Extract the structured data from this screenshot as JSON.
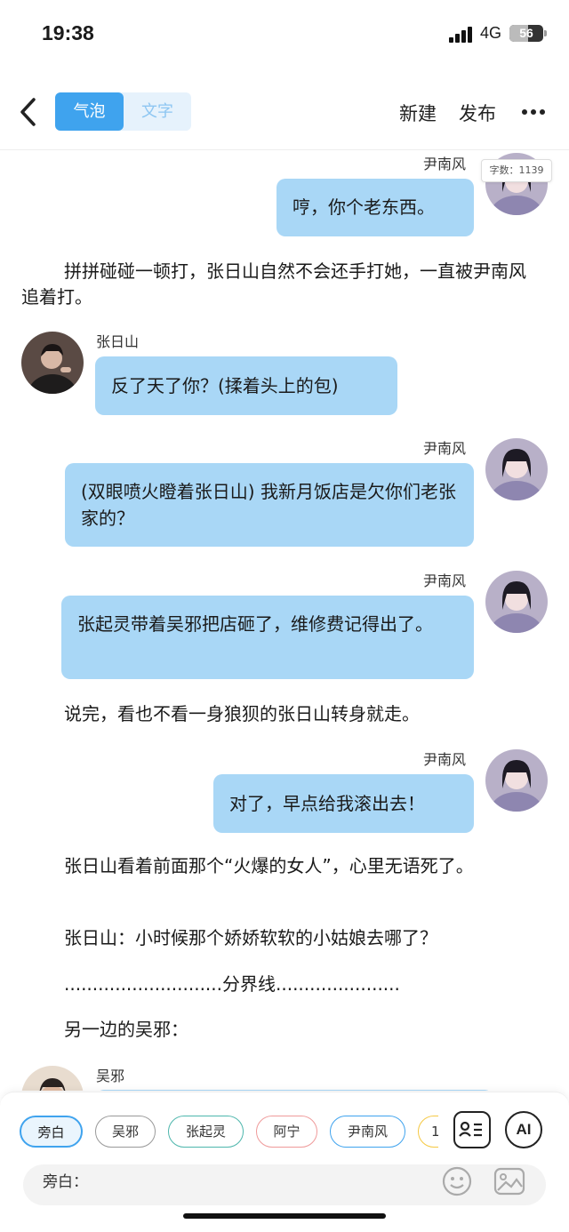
{
  "status_bar": {
    "time": "19:38",
    "network": "4G",
    "battery": "56",
    "battery_level": 0.56
  },
  "nav": {
    "tab_bubble": "气泡",
    "tab_text": "文字",
    "new": "新建",
    "publish": "发布"
  },
  "word_count": "字数：1139",
  "messages": [
    {
      "speaker": "尹南风",
      "text": "哼，你个老东西。"
    },
    {
      "narration": "拼拼碰碰一顿打，张日山自然不会还手打她，一直被尹南风追着打。"
    },
    {
      "speaker": "张日山",
      "text": "反了天了你？(揉着头上的包)"
    },
    {
      "speaker": "尹南风",
      "text": "(双眼喷火瞪着张日山) 我新月饭店是欠你们老张家的？"
    },
    {
      "speaker": "尹南风",
      "text": "张起灵带着吴邪把店砸了，维修费记得出了。"
    },
    {
      "narration": "说完，看也不看一身狼狈的张日山转身就走。"
    },
    {
      "speaker": "尹南风",
      "text": "对了，早点给我滚出去！"
    },
    {
      "narration": "张日山看着前面那个“火爆的女人”，心里无语死了。"
    },
    {
      "narration": "张日山：小时候那个娇娇软软的小姑娘去哪了？"
    },
    {
      "narration": "............................分界线......................"
    },
    {
      "narration": "另一边的吴邪："
    },
    {
      "speaker": "吴邪",
      "text": ""
    }
  ],
  "roles": [
    "旁白",
    "吴邪",
    "张起灵",
    "阿宁",
    "尹南风",
    "1"
  ],
  "role_colors": [
    "#3fa3ee",
    "#999999",
    "#4db6ac",
    "#ef9a9a",
    "#3fa3ee",
    "#f5c842"
  ],
  "toolbar": {
    "role_card_icon": "role-card-icon",
    "ai_label": "AI"
  },
  "input": {
    "label": "旁白："
  }
}
